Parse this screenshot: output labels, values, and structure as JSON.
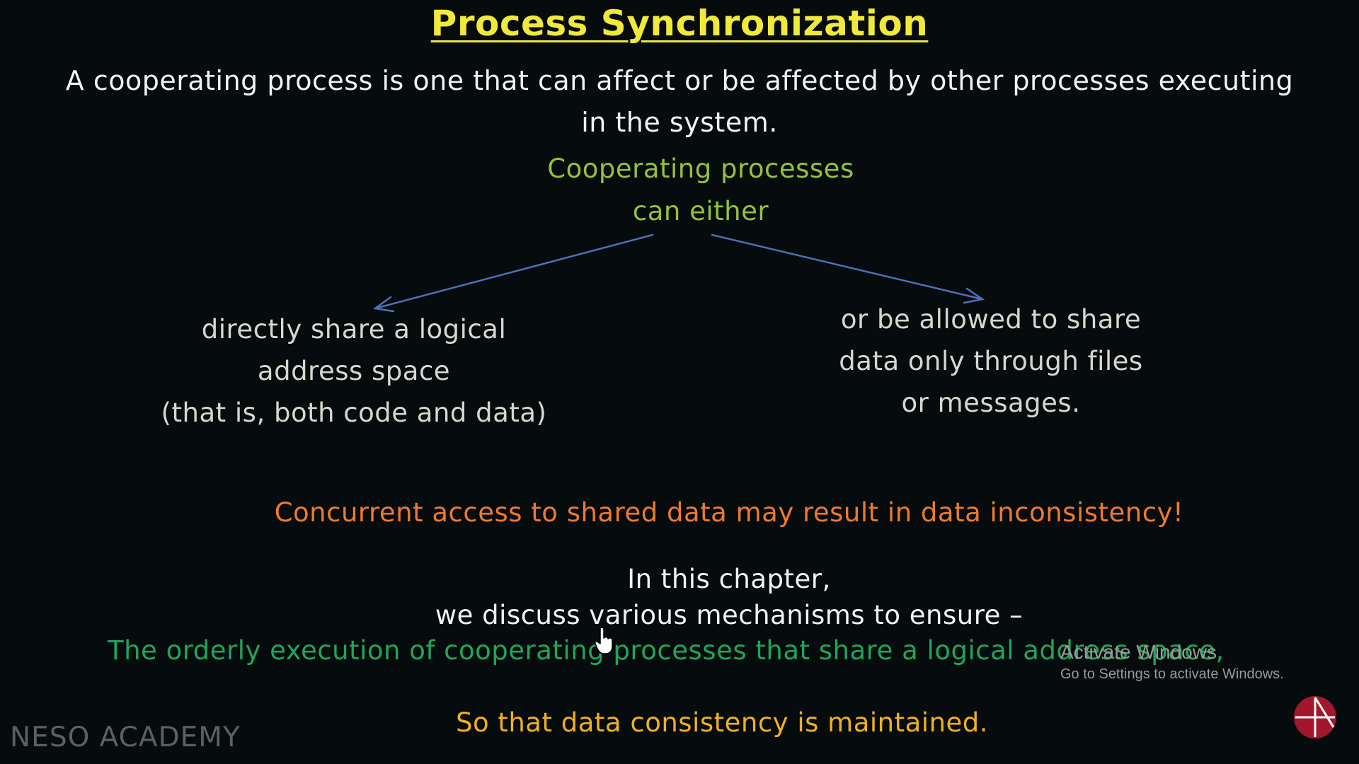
{
  "slide": {
    "title": "Process Synchronization",
    "intro_line1": "A cooperating process is one that can affect or be affected by other processes executing",
    "intro_line2": "in the system.",
    "cooperating_line1": "Cooperating processes",
    "cooperating_line2": "can either",
    "left_branch": [
      "directly share a logical",
      "address space",
      "(that is, both code and data)"
    ],
    "right_branch": [
      "or be allowed to share",
      "data only through files",
      "or messages."
    ],
    "warning": "Concurrent access to shared data may result in data inconsistency!",
    "chapter_line1": "In this chapter,",
    "chapter_line2": "we discuss various mechanisms to ensure –",
    "orderly_line": "The orderly execution of cooperating processes that share a logical address space,",
    "consistency_line": "So that data consistency is maintained."
  },
  "watermark": {
    "brand": "NESO ACADEMY"
  },
  "windows_activation": {
    "title": "Activate Windows",
    "subtitle": "Go to Settings to activate Windows."
  },
  "colors": {
    "background": "#060b0d",
    "title": "#f0e93a",
    "body_text": "#f2f2f2",
    "cooperating_text": "#93c23d",
    "branch_text": "#d7d7cf",
    "arrow": "#4a72b8",
    "warning": "#ef7a2a",
    "orderly": "#1fa55a",
    "consistency": "#f0b11f",
    "logo": "#a3172c"
  },
  "icons": {
    "cursor": "hand-pointer-icon",
    "logo": "neso-logo-icon"
  }
}
